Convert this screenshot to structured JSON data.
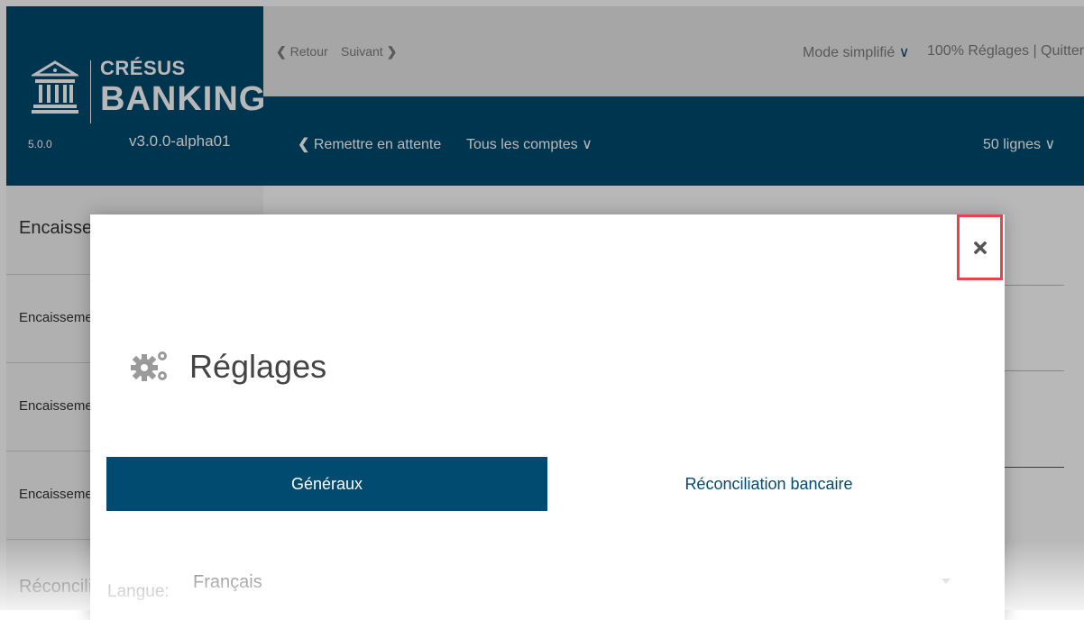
{
  "brand": {
    "title_small": "CRÉSUS",
    "title_big": "BANKING",
    "version_left": "5.0.0",
    "version_right": "v3.0.0-alpha01",
    "color": "#014a70"
  },
  "topbar": {
    "back_label": "Retour",
    "next_label": "Suivant",
    "mode_label": "Mode simplifié",
    "zoom_label": "100%",
    "settings_label": "Réglages",
    "separator": "|",
    "quit_label": "Quitter"
  },
  "toolbar": {
    "hold_label": "Remettre en attente",
    "accounts_label": "Tous les comptes",
    "lines_label": "50 lignes"
  },
  "sidebar": {
    "items": [
      {
        "label": "Encaisser"
      },
      {
        "label": "Encaisseme"
      },
      {
        "label": "Encaisseme"
      },
      {
        "label": "Encaisseme"
      },
      {
        "label": "Réconcili"
      }
    ]
  },
  "modal": {
    "close_icon": "close-icon",
    "title": "Réglages",
    "tabs": [
      {
        "label": "Généraux",
        "active": true
      },
      {
        "label": "Réconciliation bancaire",
        "active": false
      }
    ],
    "language_label": "Langue:",
    "language_value": "Français",
    "highlight_color": "#e8424b"
  }
}
